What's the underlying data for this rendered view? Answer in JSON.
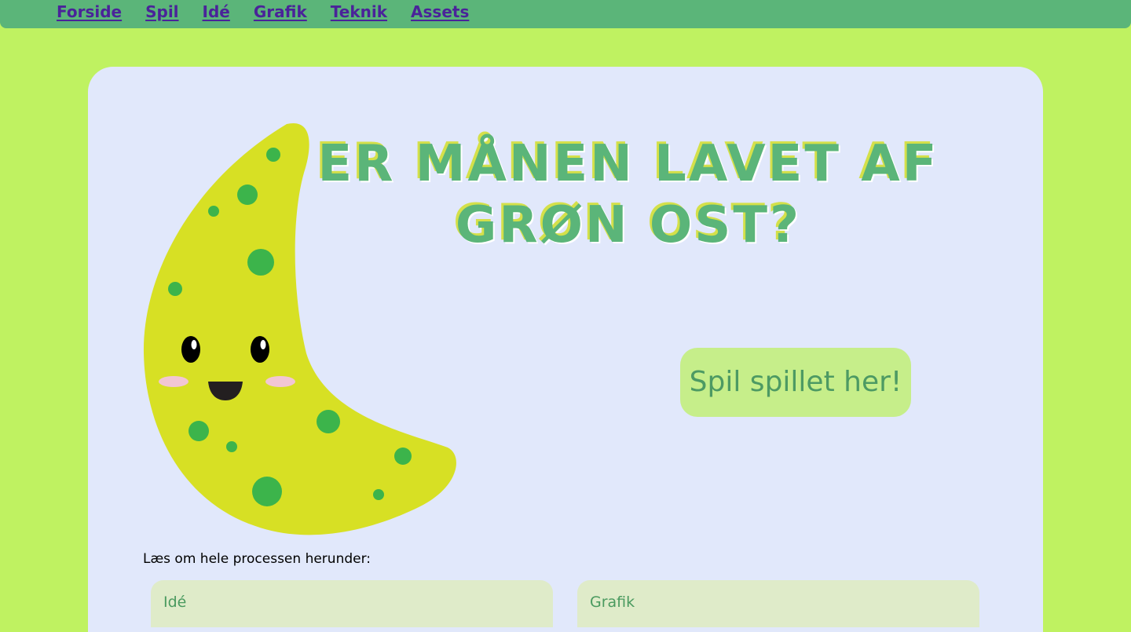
{
  "nav": {
    "items": [
      "Forside",
      "Spil",
      "Idé",
      "Grafik",
      "Teknik",
      "Assets"
    ]
  },
  "hero": {
    "title_line1": "ER MÅNEN LAVET AF",
    "title_line2": "GRØN OST?",
    "play_button": "Spil spillet her!"
  },
  "process": {
    "intro": "Læs om hele processen herunder:",
    "sections": [
      "Idé",
      "Grafik"
    ]
  },
  "colors": {
    "background": "#bff261",
    "navbar": "#5bb579",
    "nav_link": "#4a2399",
    "card": "#e1e8fb",
    "title": "#5bb579",
    "moon": "#d7e024",
    "moon_spots": "#3cb44b",
    "play_button_bg": "#c6ee8a"
  },
  "icons": {
    "moon": "moon-character-icon"
  }
}
